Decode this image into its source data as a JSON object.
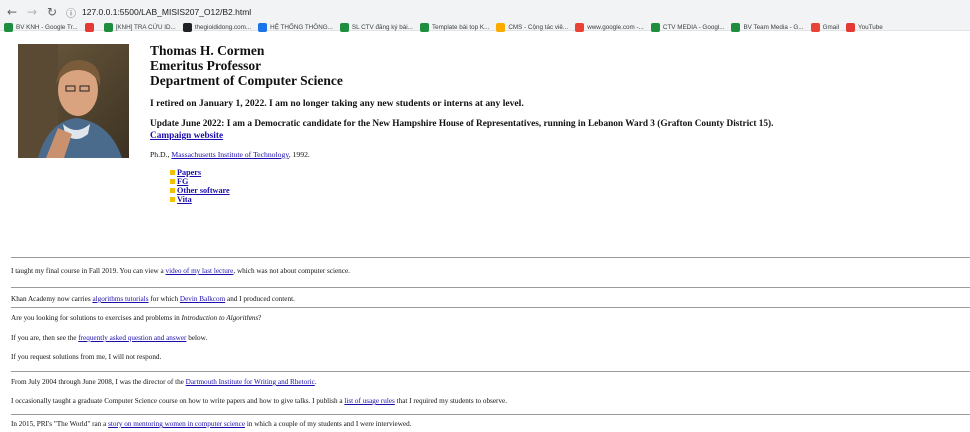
{
  "browser": {
    "url": "127.0.0.1:5500/LAB_MISIS207_O12/B2.html",
    "bookmarks": [
      {
        "label": "BV KNH - Google Tr...",
        "color": "#1e8e3e"
      },
      {
        "label": "",
        "color": "#e53935"
      },
      {
        "label": "[KNH] TRA CỨU ID...",
        "color": "#1e8e3e"
      },
      {
        "label": "thegioididong.com...",
        "color": "#202124"
      },
      {
        "label": "HỆ THỐNG THÔNG...",
        "color": "#1a73e8"
      },
      {
        "label": "SL CTV đăng ký bài...",
        "color": "#1e8e3e"
      },
      {
        "label": "Template bài top K...",
        "color": "#1e8e3e"
      },
      {
        "label": "CMS - Cộng tác viê...",
        "color": "#f9ab00"
      },
      {
        "label": "www.google.com -...",
        "color": "#ea4335"
      },
      {
        "label": "CTV MEDIA - Googl...",
        "color": "#1e8e3e"
      },
      {
        "label": "BV Team Media - G...",
        "color": "#1e8e3e"
      },
      {
        "label": "Gmail",
        "color": "#ea4335"
      },
      {
        "label": "YouTube",
        "color": "#e53935"
      }
    ]
  },
  "header": {
    "name": "Thomas H. Cormen",
    "title": "Emeritus Professor",
    "department": "Department of Computer Science",
    "retired": "I retired on January 1, 2022. I am no longer taking any new students or interns at any level.",
    "update": "Update June 2022: I am a Democratic candidate for the New Hampshire House of Representatives, running in Lebanon Ward 3 (Grafton County District 15).",
    "campaign_link": "Campaign website",
    "phd_prefix": "Ph.D., ",
    "phd_link": "Massachusetts Institute of Technology",
    "phd_suffix": ", 1992.",
    "links": [
      "Papers",
      "FG",
      "Other software",
      "Vita"
    ]
  },
  "body": {
    "p1_a": "I taught my final course in Fall 2019. You can view a ",
    "p1_link": "video of my last lecture",
    "p1_b": ", which was not about computer science.",
    "p2_a": "Khan Academy now carries ",
    "p2_link1": "algorithms tutorials",
    "p2_b": " for which ",
    "p2_link2": "Devin Balkcom",
    "p2_c": " and I produced content.",
    "p3_a": "Are you looking for solutions to exercises and problems in ",
    "p3_em": "Introduction to Algorithms",
    "p3_b": "?",
    "p4_a": "If you are, then see the ",
    "p4_link": "frequently asked question and answer",
    "p4_b": " below.",
    "p5": "If you request solutions from me, I will not respond.",
    "p6_a": "From July 2004 through June 2008, I was the director of the ",
    "p6_link": "Dartmouth Institute for Writing and Rhetoric",
    "p6_b": ".",
    "p7_a": "I occasionally taught a graduate Computer Science course on how to write papers and how to give talks. I publish a ",
    "p7_link": "list of usage rules",
    "p7_b": " that I required my students to observe.",
    "p8_a": "In 2015, PRI's \"The World\" ran a ",
    "p8_link": "story on mentoring women in computer science",
    "p8_b": " in which a couple of my students and I were interviewed."
  }
}
